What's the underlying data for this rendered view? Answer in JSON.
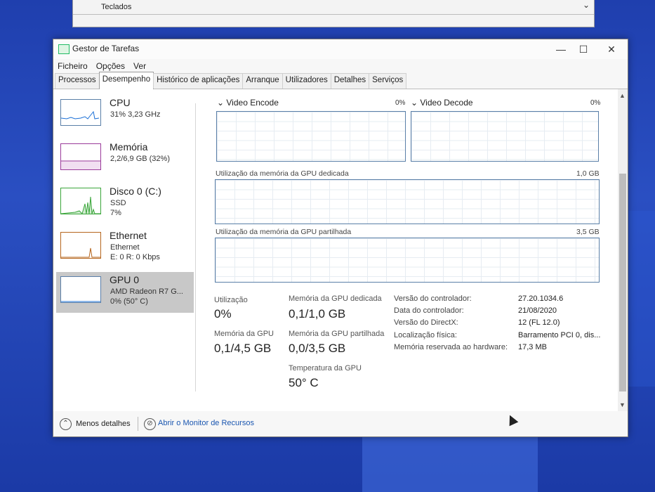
{
  "background": {
    "item_label": "Teclados"
  },
  "window": {
    "title": "Gestor de Tarefas",
    "buttons": {
      "minimize": "—",
      "maximize": "☐",
      "close": "✕"
    }
  },
  "menu": [
    "Ficheiro",
    "Opções",
    "Ver"
  ],
  "tabs": [
    "Processos",
    "Desempenho",
    "Histórico de aplicações",
    "Arranque",
    "Utilizadores",
    "Detalhes",
    "Serviços"
  ],
  "active_tab": "Desempenho",
  "sidebar": [
    {
      "title": "CPU",
      "line1": "31% 3,23 GHz",
      "line2": "",
      "color": "#1a6fd6"
    },
    {
      "title": "Memória",
      "line1": "2,2/6,9 GB (32%)",
      "line2": "",
      "color": "#9a3a9a"
    },
    {
      "title": "Disco 0 (C:)",
      "line1": "SSD",
      "line2": "7%",
      "color": "#3aa53a"
    },
    {
      "title": "Ethernet",
      "line1": "Ethernet",
      "line2": "E: 0 R: 0 Kbps",
      "color": "#b5651d"
    },
    {
      "title": "GPU 0",
      "line1": "AMD Radeon R7 G...",
      "line2": "0% (50° C)",
      "color": "#1a6fd6"
    }
  ],
  "graphs": {
    "video_encode": {
      "title": "Video Encode",
      "pct": "0%"
    },
    "video_decode": {
      "title": "Video Decode",
      "pct": "0%"
    },
    "dedicated": {
      "title": "Utilização da memória da GPU dedicada",
      "max": "1,0 GB"
    },
    "shared": {
      "title": "Utilização da memória da GPU partilhada",
      "max": "3,5 GB"
    }
  },
  "stats": {
    "utilizacao": {
      "label": "Utilização",
      "value": "0%"
    },
    "mem_dedicada": {
      "label": "Memória da GPU dedicada",
      "value": "0,1/1,0 GB"
    },
    "mem_gpu": {
      "label": "Memória da GPU",
      "value": "0,1/4,5 GB"
    },
    "mem_partilhada": {
      "label": "Memória da GPU partilhada",
      "value": "0,0/3,5 GB"
    },
    "temperatura": {
      "label": "Temperatura da GPU",
      "value": "50° C"
    }
  },
  "details": [
    {
      "key": "Versão do controlador:",
      "value": "27.20.1034.6"
    },
    {
      "key": "Data do controlador:",
      "value": "21/08/2020"
    },
    {
      "key": "Versão do DirectX:",
      "value": "12 (FL 12.0)"
    },
    {
      "key": "Localização física:",
      "value": "Barramento PCI 0, dis..."
    },
    {
      "key": "Memória reservada ao hardware:",
      "value": "17,3 MB"
    }
  ],
  "footer": {
    "less_details": "Menos detalhes",
    "resource_monitor": "Abrir o Monitor de Recursos"
  }
}
